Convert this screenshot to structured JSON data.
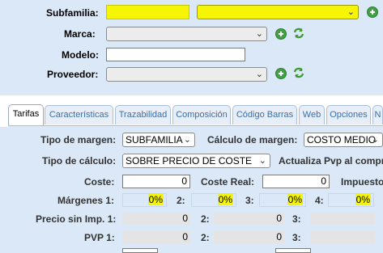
{
  "form": {
    "subfamilia": {
      "label": "Subfamilia:"
    },
    "marca": {
      "label": "Marca:"
    },
    "modelo": {
      "label": "Modelo:"
    },
    "proveedor": {
      "label": "Proveedor:"
    }
  },
  "tabs": [
    {
      "label": "Tarifas"
    },
    {
      "label": "Características"
    },
    {
      "label": "Trazabilidad"
    },
    {
      "label": "Composición"
    },
    {
      "label": "Código Barras"
    },
    {
      "label": "Web"
    },
    {
      "label": "Opciones"
    },
    {
      "label": "N"
    }
  ],
  "tarifas": {
    "tipo_margen_label": "Tipo de margen:",
    "tipo_margen_value": "SUBFAMILIA",
    "calculo_margen_label": "Cálculo de margen:",
    "calculo_margen_value": "COSTO MEDIO",
    "tipo_calculo_label": "Tipo de cálculo:",
    "tipo_calculo_value": "SOBRE PRECIO DE COSTE",
    "actualiza_label": "Actualiza Pvp al compr",
    "coste_label": "Coste:",
    "coste_value": "0",
    "coste_real_label": "Coste Real:",
    "coste_real_value": "0",
    "impuesto_label": "Impuesto",
    "margenes_label": "Márgenes 1:",
    "margenes": [
      {
        "label": "",
        "value": "0%"
      },
      {
        "label": "2:",
        "value": "0%"
      },
      {
        "label": "3:",
        "value": "0%"
      },
      {
        "label": "4:",
        "value": "0%"
      }
    ],
    "precio_sin_imp_label": "Precio sin Imp. 1:",
    "precio_sin_imp": [
      {
        "label": "",
        "value": "0"
      },
      {
        "label": "2:",
        "value": "0"
      },
      {
        "label": "3:",
        "value": ""
      }
    ],
    "pvp_label": "PVP 1:",
    "pvp": [
      {
        "label": "",
        "value": "0"
      },
      {
        "label": "2:",
        "value": "0"
      },
      {
        "label": "3:",
        "value": ""
      }
    ]
  },
  "colors": {
    "highlight": "#f5f505",
    "background": "#dbe8f7",
    "accent_green": "#43a047"
  },
  "icons": [
    "plus-circle-icon",
    "refresh-icon",
    "chevron-down-icon"
  ]
}
